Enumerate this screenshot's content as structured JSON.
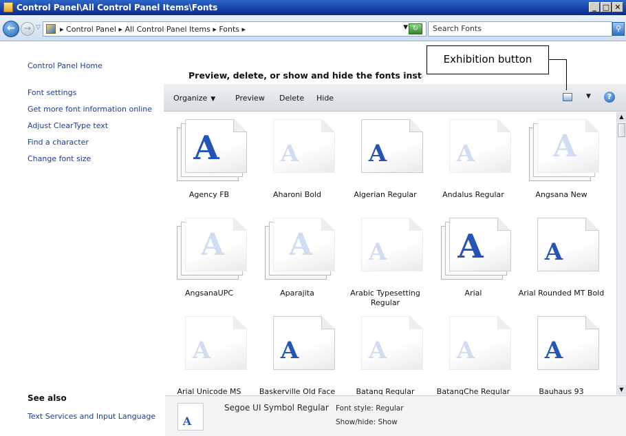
{
  "window": {
    "title": "Control Panel\\All Control Panel Items\\Fonts"
  },
  "address": {
    "crumbs": [
      "Control Panel",
      "All Control Panel Items",
      "Fonts"
    ],
    "search_placeholder": "Search Fonts"
  },
  "sidebar": {
    "home": "Control Panel Home",
    "links": [
      "Font settings",
      "Get more font information online",
      "Adjust ClearType text",
      "Find a character",
      "Change font size"
    ],
    "see_also_title": "See also",
    "see_also_links": [
      "Text Services and Input Language"
    ]
  },
  "main": {
    "heading": "Preview, delete, or show and hide the fonts installed on your computer"
  },
  "toolbar": {
    "organize": "Organize",
    "preview": "Preview",
    "delete": "Delete",
    "hide": "Hide"
  },
  "callout": {
    "label": "Exhibition button"
  },
  "fonts": [
    {
      "name": "Agency FB",
      "stacked": true,
      "dim": false
    },
    {
      "name": "Aharoni Bold",
      "stacked": false,
      "dim": true
    },
    {
      "name": "Algerian Regular",
      "stacked": false,
      "dim": false
    },
    {
      "name": "Andalus Regular",
      "stacked": false,
      "dim": true
    },
    {
      "name": "Angsana New",
      "stacked": true,
      "dim": true
    },
    {
      "name": "AngsanaUPC",
      "stacked": true,
      "dim": true
    },
    {
      "name": "Aparajita",
      "stacked": true,
      "dim": true
    },
    {
      "name": "Arabic Typesetting Regular",
      "stacked": false,
      "dim": true
    },
    {
      "name": "Arial",
      "stacked": true,
      "dim": false
    },
    {
      "name": "Arial Rounded MT Bold",
      "stacked": false,
      "dim": false
    },
    {
      "name": "Arial Unicode MS",
      "stacked": false,
      "dim": true
    },
    {
      "name": "Baskerville Old Face",
      "stacked": false,
      "dim": false
    },
    {
      "name": "Batang Regular",
      "stacked": false,
      "dim": true
    },
    {
      "name": "BatangChe Regular",
      "stacked": false,
      "dim": true
    },
    {
      "name": "Bauhaus 93",
      "stacked": false,
      "dim": false
    }
  ],
  "details": {
    "font_name": "Segoe UI Symbol Regular",
    "font_style": "Font style: Regular",
    "show_hide": "Show/hide: Show"
  },
  "icons": [
    "folder-icon",
    "back-arrow-icon",
    "forward-arrow-icon",
    "refresh-icon",
    "search-icon",
    "view-icon",
    "help-icon",
    "font-file-icon"
  ]
}
